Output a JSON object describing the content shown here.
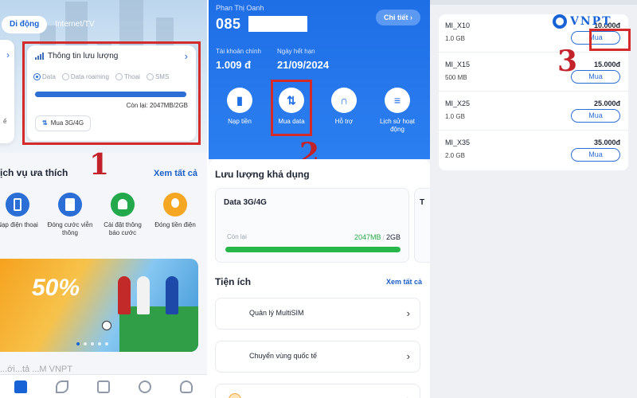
{
  "panel1": {
    "tabs": [
      "Di động",
      "Internet/TV"
    ],
    "card": {
      "title": "Thông tin lưu lượng",
      "options": [
        "Data",
        "Data roaming",
        "Thoại",
        "SMS"
      ],
      "selected": "Data",
      "remaining": "Còn lại: 2047MB/2GB",
      "usage_fraction": 0.9995,
      "buy_button": "Mua 3G/4G"
    },
    "left_card_char": "ế",
    "step": "1",
    "fav_title": "ịch vụ ưa thích",
    "see_all": "Xem tất cả",
    "services": [
      {
        "label": "Nạp điện thoại",
        "color": "#2b6fd6"
      },
      {
        "label": "Đóng cước viễn thông",
        "color": "#2b6fd6"
      },
      {
        "label": "Cài đặt thông báo cước",
        "color": "#23a84b"
      },
      {
        "label": "Đóng tiền điện",
        "color": "#f5a623"
      }
    ],
    "banner_percent": "50%",
    "bottom_text": "...ới...tả ...M VNPT"
  },
  "panel2": {
    "name": "Phan Thị Oanh",
    "phone": "085",
    "detail_button": "Chi tiết",
    "main_account_label": "Tài khoản chính",
    "main_account_value": "1.009 đ",
    "expiry_label": "Ngày hết hạn",
    "expiry_value": "21/09/2024",
    "actions": [
      "Nạp tiền",
      "Mua data",
      "Hỗ trợ",
      "Lịch sử hoạt động"
    ],
    "step": "2",
    "usage_title": "Lưu lượng khả dụng",
    "data_card": {
      "title": "Data 3G/4G",
      "remain_label": "Còn lại",
      "used": "2047MB",
      "separator": "/",
      "total": "2GB",
      "usage_fraction": 0.9995
    },
    "peek_card_char": "T",
    "utilities_title": "Tiện ích",
    "utilities_see_all": "Xem tất cả",
    "utilities": [
      "Quản lý MultiSIM",
      "Chuyển vùng quốc tế"
    ]
  },
  "panel3": {
    "packages": [
      {
        "name": "MI_X10",
        "price": "10.000đ",
        "data": "1.0 GB",
        "button": "Mua"
      },
      {
        "name": "MI_X15",
        "price": "15.000đ",
        "data": "500 MB",
        "button": "Mua"
      },
      {
        "name": "MI_X25",
        "price": "25.000đ",
        "data": "1.0 GB",
        "button": "Mua"
      },
      {
        "name": "MI_X35",
        "price": "35.000đ",
        "data": "2.0 GB",
        "button": "Mua"
      }
    ],
    "step": "3",
    "brand": "VNPT"
  },
  "colors": {
    "primary": "#1e6ee6",
    "highlight_red": "#d42a2a",
    "step_red": "#c3222a",
    "green": "#27b64a"
  }
}
